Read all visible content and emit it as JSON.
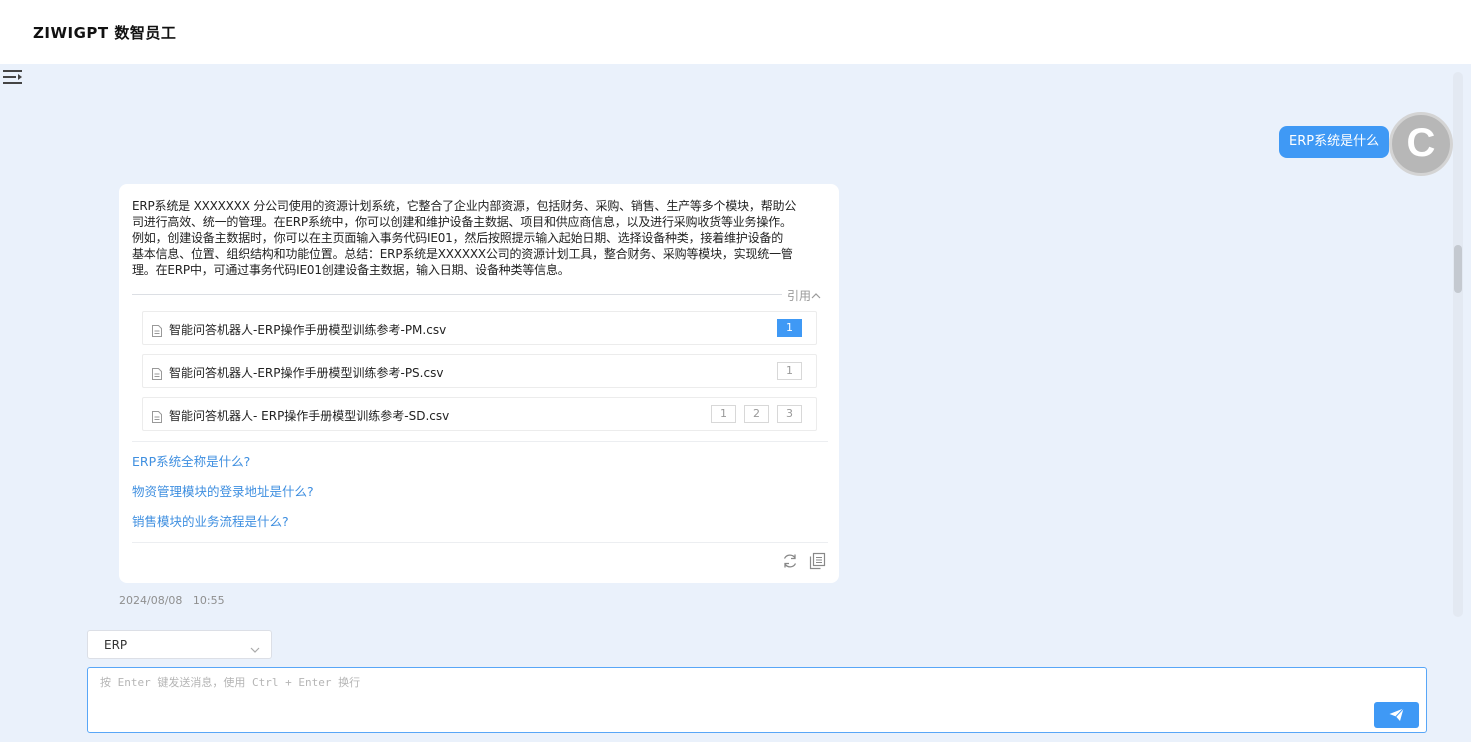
{
  "app": {
    "title": "ZIWIGPT 数智员工"
  },
  "colors": {
    "accent": "#3f99f5",
    "link": "#3f8fe0",
    "background": "#eaf1fb"
  },
  "user_message": {
    "text": "ERP系统是什么",
    "avatar_letter": "C"
  },
  "answer": {
    "lines": [
      "ERP系统是 XXXXXXX 分公司使用的资源计划系统，它整合了企业内部资源，包括财务、采购、销售、生产等多个模块，帮助公",
      "司进行高效、统一的管理。在ERP系统中，你可以创建和维护设备主数据、项目和供应商信息，以及进行采购收货等业务操作。",
      "例如，创建设备主数据时，你可以在主页面输入事务代码IE01，然后按照提示输入起始日期、选择设备种类，接着维护设备的",
      "基本信息、位置、组织结构和功能位置。总结：ERP系统是XXXXXX公司的资源计划工具，整合财务、采购等模块，实现统一管",
      "理。在ERP中，可通过事务代码IE01创建设备主数据，输入日期、设备种类等信息。"
    ],
    "references_label": "引用",
    "references": [
      {
        "name": "智能问答机器人-ERP操作手册模型训练参考-PM.csv",
        "tags": [
          "1"
        ],
        "active": 0
      },
      {
        "name": "智能问答机器人-ERP操作手册模型训练参考-PS.csv",
        "tags": [
          "1"
        ],
        "active": -1
      },
      {
        "name": "智能问答机器人- ERP操作手册模型训练参考-SD.csv",
        "tags": [
          "1",
          "2",
          "3"
        ],
        "active": -1
      }
    ],
    "suggestions": [
      "ERP系统全称是什么?",
      "物资管理模块的登录地址是什么?",
      "销售模块的业务流程是什么?"
    ],
    "actions": [
      "refresh-icon",
      "copy-icon"
    ],
    "timestamp": "2024/08/08   10:55"
  },
  "composer": {
    "knowledge_base": "ERP",
    "placeholder": "按 Enter 键发送消息，使用 Ctrl + Enter 换行",
    "value": ""
  }
}
